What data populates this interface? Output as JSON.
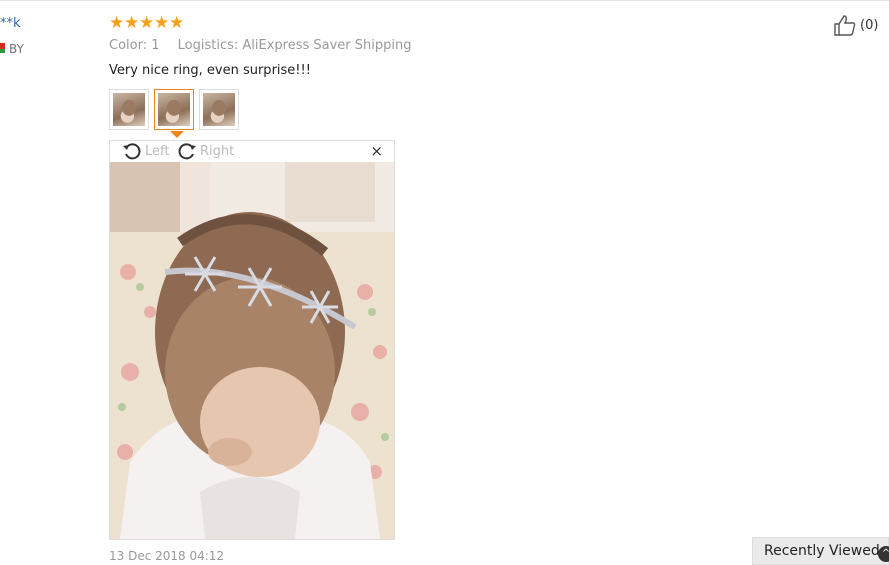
{
  "reviewer": {
    "name": "**k",
    "country": "BY"
  },
  "rating": {
    "stars": 5,
    "max": 5
  },
  "meta": {
    "color": "Color: 1",
    "logistics": "Logistics: AliExpress Saver Shipping"
  },
  "review_text": "Very nice ring, even surprise!!!",
  "photos": {
    "count": 3,
    "selected_index": 1
  },
  "viewer": {
    "rotate_left_label": "Left",
    "rotate_right_label": "Right",
    "close_glyph": "×"
  },
  "date": "13 Dec 2018 04:12",
  "helpful": {
    "count_label": "(0)"
  },
  "recently_viewed": {
    "label": "Recently Viewed"
  },
  "colors": {
    "star": "#f7a11a",
    "accent": "#f08419",
    "link": "#3366aa",
    "muted": "#999999"
  }
}
